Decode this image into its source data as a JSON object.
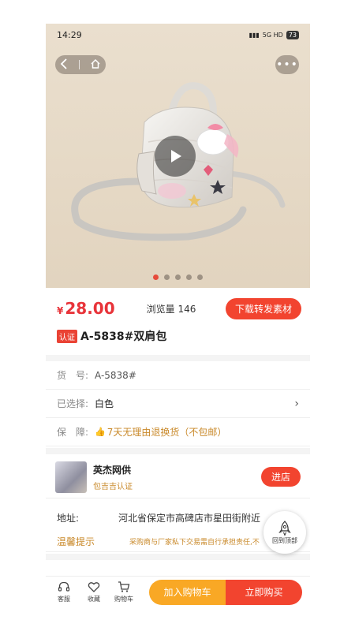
{
  "status_bar": {
    "time": "14:29",
    "network": "5G HD",
    "battery": "73"
  },
  "colors": {
    "accent_red": "#f2442f",
    "price_red": "#e8343a",
    "gold": "#c9892a",
    "cart_orange": "#f9a825"
  },
  "gallery": {
    "image_count": 5,
    "active_index": 0
  },
  "product": {
    "currency": "¥",
    "price": "28.00",
    "views": "浏览量 146",
    "download_label": "下载转发素材",
    "cert_badge": "认证",
    "title": "A-5838#双肩包"
  },
  "details": {
    "sku_label": "货　号:",
    "sku_value": "A-5838#",
    "selected_label": "已选择:",
    "selected_value": "白色",
    "guarantee_label": "保　障:",
    "guarantee_value": "7天无理由退换货（不包邮）"
  },
  "shop": {
    "name": "英杰网供",
    "badge": "包吉吉认证",
    "enter_label": "进店"
  },
  "address": {
    "label": "地址:",
    "value": "河北省保定市高碑店市星田街附近"
  },
  "notice": {
    "label": "温馨提示",
    "value": "采购商与厂家私下交易需自行承担责任,不"
  },
  "back_to_top": "回到顶部",
  "bottom_bar": {
    "service": "客服",
    "favorite": "收藏",
    "cart": "购物车",
    "add_to_cart": "加入购物车",
    "buy_now": "立即购买"
  }
}
